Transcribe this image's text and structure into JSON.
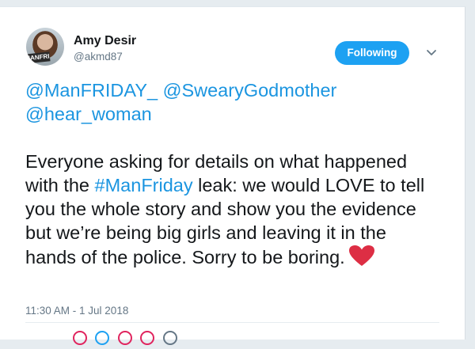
{
  "user": {
    "display_name": "Amy Desir",
    "handle": "@akmd87",
    "avatar_badge": "MANFRI"
  },
  "follow_button": {
    "label": "Following"
  },
  "tweet": {
    "mentions": [
      "@ManFRIDAY_",
      "@SwearyGodmother",
      "@hear_woman"
    ],
    "body_part1": "Everyone asking for details on what happened with the ",
    "hashtag": "#ManFriday",
    "body_part2": " leak: we would LOVE to tell you the whole story and show you the evidence but we’re being big girls and leaving it in the hands of the police. Sorry to be boring.",
    "emoji": "red-heart-icon",
    "timestamp": "11:30 AM - 1 Jul 2018"
  },
  "colors": {
    "accent": "#1da1f2",
    "link": "#1b95e0",
    "heart": "#e0245e",
    "muted": "#657786"
  }
}
